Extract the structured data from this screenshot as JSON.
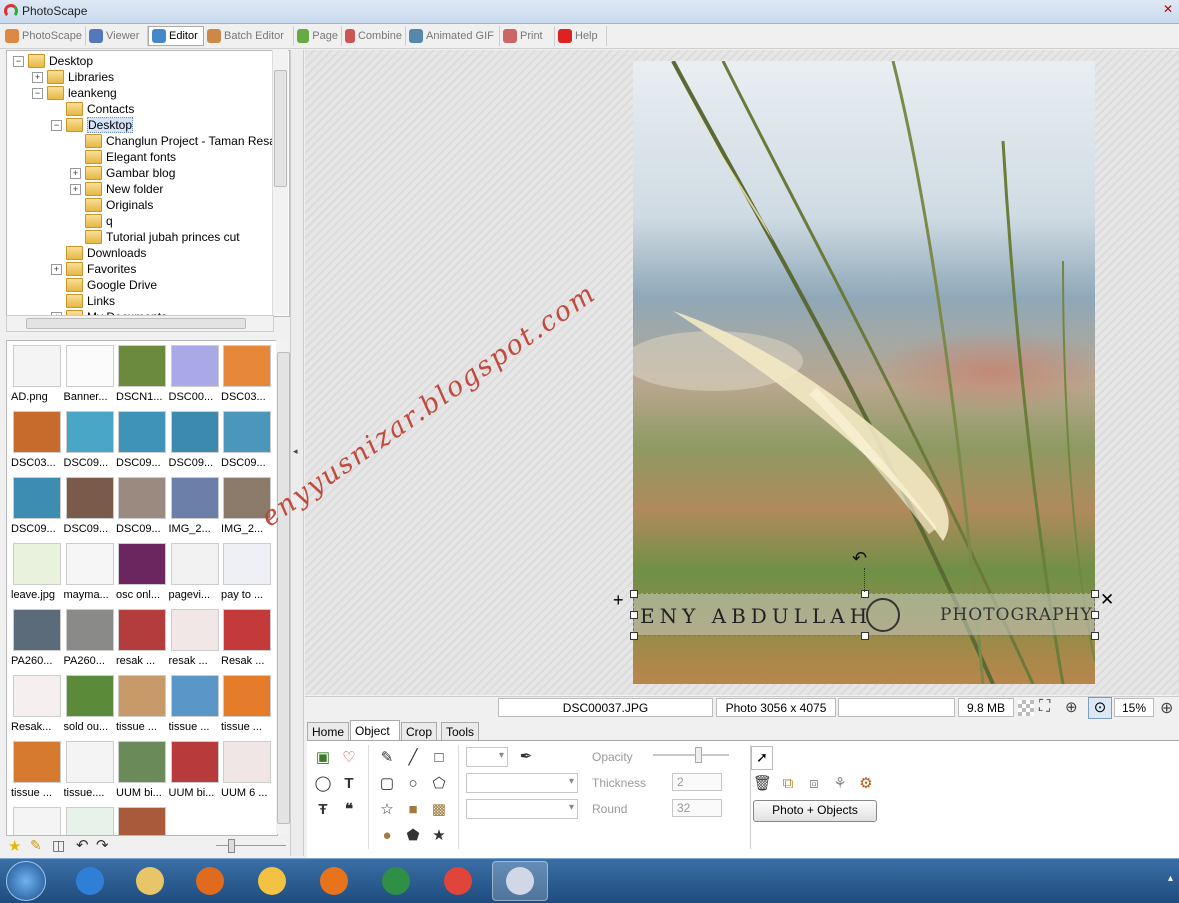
{
  "window": {
    "title": "PhotoScape"
  },
  "menu_tabs": [
    {
      "label": "PhotoScape",
      "icon": "photoscape-icon",
      "color": "#d84"
    },
    {
      "label": "Viewer",
      "icon": "viewer-icon",
      "color": "#57b"
    },
    {
      "label": "Editor",
      "icon": "editor-icon",
      "color": "#48c"
    },
    {
      "label": "Batch Editor",
      "icon": "batch-editor-icon",
      "color": "#c84"
    },
    {
      "label": "Page",
      "icon": "page-icon",
      "color": "#6a4"
    },
    {
      "label": "Combine",
      "icon": "combine-icon",
      "color": "#c55"
    },
    {
      "label": "Animated GIF",
      "icon": "animated-gif-icon",
      "color": "#58a"
    },
    {
      "label": "Print",
      "icon": "print-icon",
      "color": "#c66"
    },
    {
      "label": "Help",
      "icon": "help-icon",
      "color": "#d22"
    }
  ],
  "tree": [
    {
      "label": "Desktop",
      "level": 0,
      "exp": "−"
    },
    {
      "label": "Libraries",
      "level": 1,
      "exp": "+"
    },
    {
      "label": "leankeng",
      "level": 1,
      "exp": "−"
    },
    {
      "label": "Contacts",
      "level": 2,
      "exp": ""
    },
    {
      "label": "Desktop",
      "level": 2,
      "exp": "−",
      "selected": true
    },
    {
      "label": "Changlun Project - Taman Resak",
      "level": 3,
      "exp": ""
    },
    {
      "label": "Elegant fonts",
      "level": 3,
      "exp": ""
    },
    {
      "label": "Gambar blog",
      "level": 3,
      "exp": "+"
    },
    {
      "label": "New folder",
      "level": 3,
      "exp": "+"
    },
    {
      "label": "Originals",
      "level": 3,
      "exp": ""
    },
    {
      "label": "q",
      "level": 3,
      "exp": ""
    },
    {
      "label": "Tutorial jubah princes cut",
      "level": 3,
      "exp": ""
    },
    {
      "label": "Downloads",
      "level": 2,
      "exp": ""
    },
    {
      "label": "Favorites",
      "level": 2,
      "exp": "+"
    },
    {
      "label": "Google Drive",
      "level": 2,
      "exp": ""
    },
    {
      "label": "Links",
      "level": 2,
      "exp": ""
    },
    {
      "label": "My Documents",
      "level": 2,
      "exp": "+"
    }
  ],
  "thumbnails": [
    {
      "caption": "AD.png",
      "color": "#f4f4f4"
    },
    {
      "caption": "Banner...",
      "color": "#fbfbfb"
    },
    {
      "caption": "DSCN1...",
      "color": "#6b8a3e"
    },
    {
      "caption": "DSC00...",
      "color": "#a9a9e8"
    },
    {
      "caption": "DSC03...",
      "color": "#e7873a"
    },
    {
      "caption": "DSC03...",
      "color": "#c66b2b"
    },
    {
      "caption": "DSC09...",
      "color": "#4aa6c7"
    },
    {
      "caption": "DSC09...",
      "color": "#3f93b8"
    },
    {
      "caption": "DSC09...",
      "color": "#3d8ab0"
    },
    {
      "caption": "DSC09...",
      "color": "#4b97bc"
    },
    {
      "caption": "DSC09...",
      "color": "#3c8db1"
    },
    {
      "caption": "DSC09...",
      "color": "#7a5a4a"
    },
    {
      "caption": "DSC09...",
      "color": "#9b8a80"
    },
    {
      "caption": "IMG_2...",
      "color": "#6b7fa8"
    },
    {
      "caption": "IMG_2...",
      "color": "#8c7b6a"
    },
    {
      "caption": "leave.jpg",
      "color": "#e9f2dc"
    },
    {
      "caption": "mayma...",
      "color": "#f6f6f6"
    },
    {
      "caption": "osc onl...",
      "color": "#6b2660"
    },
    {
      "caption": "pagevi...",
      "color": "#f2f2f2"
    },
    {
      "caption": "pay to ...",
      "color": "#eef0f5"
    },
    {
      "caption": "PA260...",
      "color": "#5c6b7a"
    },
    {
      "caption": "PA260...",
      "color": "#8a8a88"
    },
    {
      "caption": "resak ...",
      "color": "#b33c3c"
    },
    {
      "caption": "resak ...",
      "color": "#f1e7e7"
    },
    {
      "caption": "Resak ...",
      "color": "#c43a3a"
    },
    {
      "caption": "Resak...",
      "color": "#f6efef"
    },
    {
      "caption": "sold ou...",
      "color": "#5a8a3a"
    },
    {
      "caption": "tissue ...",
      "color": "#c89a6a"
    },
    {
      "caption": "tissue ...",
      "color": "#5a96c8"
    },
    {
      "caption": "tissue ...",
      "color": "#e57c2c"
    },
    {
      "caption": "tissue ...",
      "color": "#d67a30"
    },
    {
      "caption": "tissue....",
      "color": "#f4f4f4"
    },
    {
      "caption": "UUM bi...",
      "color": "#6a8a5a"
    },
    {
      "caption": "UUM bi...",
      "color": "#b83a3a"
    },
    {
      "caption": "UUM 6 ...",
      "color": "#f0e6e6"
    },
    {
      "caption": "",
      "color": "#f4f4f4"
    },
    {
      "caption": "",
      "color": "#e7f3ea"
    },
    {
      "caption": "",
      "color": "#a85a3a"
    }
  ],
  "watermark": {
    "text": "enyyusnizar.blogspot.com",
    "color": "#c0392b"
  },
  "overlay": {
    "text": "ENY ABDULLAH",
    "suffix": "PHOTOGRAPHY"
  },
  "status": {
    "filename": "DSC00037.JPG",
    "dimensions": "Photo 3056 x 4075",
    "size": "9.8 MB",
    "zoom": "15%"
  },
  "editor_tabs": [
    "Home",
    "Object",
    "Crop",
    "Tools"
  ],
  "editor": {
    "opacity_label": "Opacity",
    "thickness_label": "Thickness",
    "thickness_value": "2",
    "round_label": "Round",
    "round_value": "32",
    "photo_objects_button": "Photo + Objects"
  },
  "taskbar": [
    {
      "name": "ie-icon",
      "color": "#2f7fd6"
    },
    {
      "name": "explorer-icon",
      "color": "#e9c56a"
    },
    {
      "name": "media-player-icon",
      "color": "#e06a1e"
    },
    {
      "name": "mail-icon",
      "color": "#f3c242"
    },
    {
      "name": "firefox-icon",
      "color": "#e8731d"
    },
    {
      "name": "excel-icon",
      "color": "#2f8f46"
    },
    {
      "name": "chrome-icon",
      "color": "#e0443a"
    },
    {
      "name": "photoscape-taskbar-icon",
      "color": "#cfd8e4"
    }
  ]
}
